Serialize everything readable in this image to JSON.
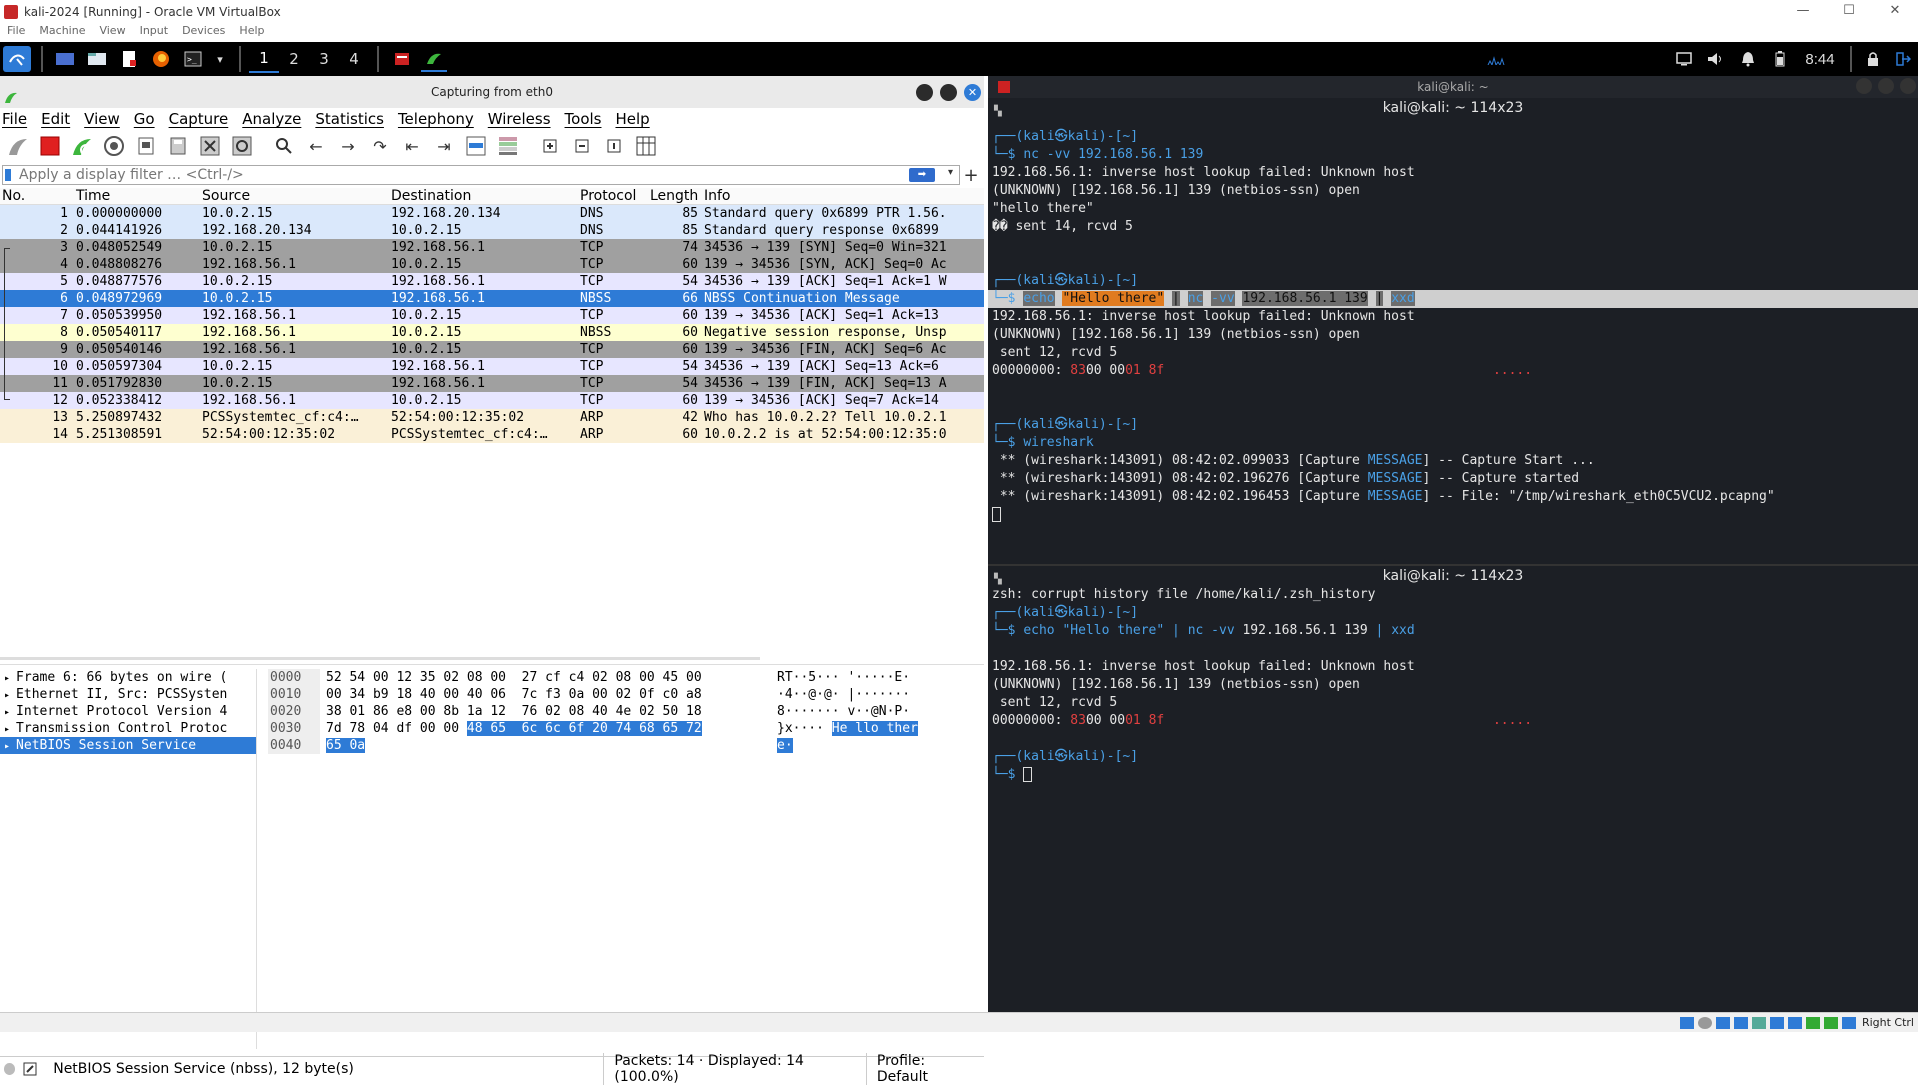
{
  "vbox": {
    "title": "kali-2024 [Running] - Oracle VM VirtualBox",
    "menu": [
      "File",
      "Machine",
      "View",
      "Input",
      "Devices",
      "Help"
    ],
    "min": "—",
    "max": "☐",
    "close": "✕",
    "host_key": "Right Ctrl"
  },
  "panel": {
    "workspaces": [
      "1",
      "2",
      "3",
      "4"
    ],
    "clock": "8:44"
  },
  "wireshark": {
    "title": "Capturing from eth0",
    "menu": [
      "File",
      "Edit",
      "View",
      "Go",
      "Capture",
      "Analyze",
      "Statistics",
      "Telephony",
      "Wireless",
      "Tools",
      "Help"
    ],
    "filter_placeholder": "Apply a display filter … <Ctrl-/>",
    "columns": [
      "No.",
      "Time",
      "Source",
      "Destination",
      "Protocol",
      "Length",
      "Info"
    ],
    "packets": [
      {
        "no": "1",
        "time": "0.000000000",
        "src": "10.0.2.15",
        "dst": "192.168.20.134",
        "proto": "DNS",
        "len": "85",
        "info": "Standard query 0x6899 PTR 1.56.",
        "bg": "#dae8fb",
        "fg": "#000"
      },
      {
        "no": "2",
        "time": "0.044141926",
        "src": "192.168.20.134",
        "dst": "10.0.2.15",
        "proto": "DNS",
        "len": "85",
        "info": "Standard query response 0x6899",
        "bg": "#dae8fb",
        "fg": "#000"
      },
      {
        "no": "3",
        "time": "0.048052549",
        "src": "10.0.2.15",
        "dst": "192.168.56.1",
        "proto": "TCP",
        "len": "74",
        "info": "34536 → 139 [SYN] Seq=0 Win=321",
        "bg": "#a0a0a0",
        "fg": "#000"
      },
      {
        "no": "4",
        "time": "0.048808276",
        "src": "192.168.56.1",
        "dst": "10.0.2.15",
        "proto": "TCP",
        "len": "60",
        "info": "139 → 34536 [SYN, ACK] Seq=0 Ac",
        "bg": "#a0a0a0",
        "fg": "#000"
      },
      {
        "no": "5",
        "time": "0.048877576",
        "src": "10.0.2.15",
        "dst": "192.168.56.1",
        "proto": "TCP",
        "len": "54",
        "info": "34536 → 139 [ACK] Seq=1 Ack=1 W",
        "bg": "#e7e6ff",
        "fg": "#000"
      },
      {
        "no": "6",
        "time": "0.048972969",
        "src": "10.0.2.15",
        "dst": "192.168.56.1",
        "proto": "NBSS",
        "len": "66",
        "info": "NBSS Continuation Message",
        "bg": "#2e7bd6",
        "fg": "#fff"
      },
      {
        "no": "7",
        "time": "0.050539950",
        "src": "192.168.56.1",
        "dst": "10.0.2.15",
        "proto": "TCP",
        "len": "60",
        "info": "139 → 34536 [ACK] Seq=1 Ack=13",
        "bg": "#e7e6ff",
        "fg": "#000"
      },
      {
        "no": "8",
        "time": "0.050540117",
        "src": "192.168.56.1",
        "dst": "10.0.2.15",
        "proto": "NBSS",
        "len": "60",
        "info": "Negative session response, Unsp",
        "bg": "#feffd0",
        "fg": "#000"
      },
      {
        "no": "9",
        "time": "0.050540146",
        "src": "192.168.56.1",
        "dst": "10.0.2.15",
        "proto": "TCP",
        "len": "60",
        "info": "139 → 34536 [FIN, ACK] Seq=6 Ac",
        "bg": "#a0a0a0",
        "fg": "#000"
      },
      {
        "no": "10",
        "time": "0.050597304",
        "src": "10.0.2.15",
        "dst": "192.168.56.1",
        "proto": "TCP",
        "len": "54",
        "info": "34536 → 139 [ACK] Seq=13 Ack=6",
        "bg": "#e7e6ff",
        "fg": "#000"
      },
      {
        "no": "11",
        "time": "0.051792830",
        "src": "10.0.2.15",
        "dst": "192.168.56.1",
        "proto": "TCP",
        "len": "54",
        "info": "34536 → 139 [FIN, ACK] Seq=13 A",
        "bg": "#a0a0a0",
        "fg": "#000"
      },
      {
        "no": "12",
        "time": "0.052338412",
        "src": "192.168.56.1",
        "dst": "10.0.2.15",
        "proto": "TCP",
        "len": "60",
        "info": "139 → 34536 [ACK] Seq=7 Ack=14",
        "bg": "#e7e6ff",
        "fg": "#000"
      },
      {
        "no": "13",
        "time": "5.250897432",
        "src": "PCSSystemtec_cf:c4:…",
        "dst": "52:54:00:12:35:02",
        "proto": "ARP",
        "len": "42",
        "info": "Who has 10.0.2.2? Tell 10.0.2.1",
        "bg": "#faf0d7",
        "fg": "#000"
      },
      {
        "no": "14",
        "time": "5.251308591",
        "src": "52:54:00:12:35:02",
        "dst": "PCSSystemtec_cf:c4:…",
        "proto": "ARP",
        "len": "60",
        "info": "10.0.2.2 is at 52:54:00:12:35:0",
        "bg": "#faf0d7",
        "fg": "#000"
      }
    ],
    "tree": [
      {
        "text": "Frame 6: 66 bytes on wire (",
        "sel": false
      },
      {
        "text": "Ethernet II, Src: PCSSysten",
        "sel": false
      },
      {
        "text": "Internet Protocol Version 4",
        "sel": false
      },
      {
        "text": "Transmission Control Protoc",
        "sel": false
      },
      {
        "text": "NetBIOS Session Service",
        "sel": true
      }
    ],
    "hex": [
      {
        "off": "0000",
        "a": "52 54 00 12 35 02 08 00  27 cf c4 02 08 00 45 00",
        "ah": "",
        "b": "RT··5··· '·····E·",
        "bh": ""
      },
      {
        "off": "0010",
        "a": "00 34 b9 18 40 00 40 06  7c f3 0a 00 02 0f c0 a8",
        "ah": "",
        "b": "·4··@·@· |·······",
        "bh": ""
      },
      {
        "off": "0020",
        "a": "38 01 86 e8 00 8b 1a 12  76 02 08 40 4e 02 50 18",
        "ah": "",
        "b": "8······· v··@N·P·",
        "bh": ""
      },
      {
        "off": "0030",
        "a": "7d 78 04 df 00 00 ",
        "ah": "48 65  6c 6c 6f 20 74 68 65 72",
        "b": "}x···· ",
        "bh": "He llo ther"
      },
      {
        "off": "0040",
        "a": "",
        "ah": "65 0a",
        "b": "",
        "bh": "e·"
      }
    ],
    "status": {
      "selection": "NetBIOS Session Service (nbss), 12 byte(s)",
      "packets": "Packets: 14 · Displayed: 14 (100.0%)",
      "profile": "Profile: Default"
    }
  },
  "terminal": {
    "window_title": "kali@kali: ~",
    "pane_title": "kali@kali: ~ 114x23",
    "prompt_user": "(kali㉿kali)-[~]",
    "top": [
      {
        "type": "prompt"
      },
      {
        "type": "cmd",
        "text": "nc -vv 192.168.56.1 139"
      },
      {
        "type": "out",
        "text": "192.168.56.1: inverse host lookup failed: Unknown host"
      },
      {
        "type": "out",
        "text": "(UNKNOWN) [192.168.56.1] 139 (netbios-ssn) open"
      },
      {
        "type": "out",
        "text": "\"hello there\""
      },
      {
        "type": "out",
        "text": "�� sent 14, rcvd 5"
      },
      {
        "type": "blank"
      },
      {
        "type": "blank"
      },
      {
        "type": "prompt"
      },
      {
        "type": "cmdhl"
      },
      {
        "type": "out",
        "text": "192.168.56.1: inverse host lookup failed: Unknown host"
      },
      {
        "type": "out",
        "text": "(UNKNOWN) [192.168.56.1] 139 (netbios-ssn) open"
      },
      {
        "type": "out",
        "text": " sent 12, rcvd 5"
      },
      {
        "type": "xxd"
      },
      {
        "type": "blank"
      },
      {
        "type": "blank"
      },
      {
        "type": "prompt"
      },
      {
        "type": "cmd",
        "text": "wireshark"
      },
      {
        "type": "msg",
        "pre": " ** (wireshark:143091) 08:42:02.099033 [Capture ",
        "post": "] -- Capture Start ..."
      },
      {
        "type": "msg",
        "pre": " ** (wireshark:143091) 08:42:02.196276 [Capture ",
        "post": "] -- Capture started"
      },
      {
        "type": "msg",
        "pre": " ** (wireshark:143091) 08:42:02.196453 [Capture ",
        "post": "] -- File: \"/tmp/wireshark_eth0C5VCU2.pcapng\""
      },
      {
        "type": "cursor"
      }
    ],
    "bottom": [
      {
        "type": "out",
        "text": "zsh: corrupt history file /home/kali/.zsh_history"
      },
      {
        "type": "prompt"
      },
      {
        "type": "cmdpipe"
      },
      {
        "type": "blank"
      },
      {
        "type": "out",
        "text": "192.168.56.1: inverse host lookup failed: Unknown host"
      },
      {
        "type": "out",
        "text": "(UNKNOWN) [192.168.56.1] 139 (netbios-ssn) open"
      },
      {
        "type": "out",
        "text": " sent 12, rcvd 5"
      },
      {
        "type": "xxd"
      },
      {
        "type": "blank"
      },
      {
        "type": "prompt"
      },
      {
        "type": "cursor"
      }
    ],
    "cmd_parts": {
      "echo": "echo",
      "str": "\"Hello there\"",
      "pipe": "|",
      "nc": "nc",
      "flag": "-vv",
      "args": "192.168.56.1 139",
      "xxd": "xxd"
    },
    "msg_word": "MESSAGE",
    "xxd": {
      "addr": "00000000: ",
      "b1": "83",
      "b2": "00 00",
      "b3": "01",
      "b4": "8f",
      "dots": "....."
    }
  }
}
